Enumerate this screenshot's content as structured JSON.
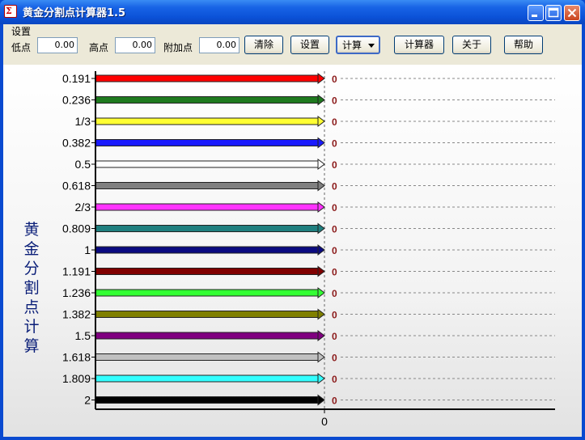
{
  "window": {
    "title": "黄金分割点计算器1.5",
    "icon": "golden-ratio-app-icon"
  },
  "toolbar": {
    "menu_label": "设置",
    "low_label": "低点",
    "low_value": "0.00",
    "high_label": "高点",
    "high_value": "0.00",
    "extra_label": "附加点",
    "extra_value": "0.00",
    "clear_label": "清除",
    "settings_label": "设置",
    "calc_label": "计算",
    "calculator_label": "计算器",
    "about_label": "关于",
    "help_label": "帮助"
  },
  "chart_title": "黄金分割点计算",
  "chart_data": {
    "type": "bar",
    "orientation": "horizontal",
    "categories": [
      "0.191",
      "0.236",
      "1/3",
      "0.382",
      "0.5",
      "0.618",
      "2/3",
      "0.809",
      "1",
      "1.191",
      "1.236",
      "1.382",
      "1.5",
      "1.618",
      "1.809",
      "2"
    ],
    "values": [
      0,
      0,
      0,
      0,
      0,
      0,
      0,
      0,
      0,
      0,
      0,
      0,
      0,
      0,
      0,
      0
    ],
    "value_labels": [
      "0",
      "0",
      "0",
      "0",
      "0",
      "0",
      "0",
      "0",
      "0",
      "0",
      "0",
      "0",
      "0",
      "0",
      "0",
      "0"
    ],
    "colors": [
      "#ff0000",
      "#1f7a1f",
      "#ffff33",
      "#1a1aff",
      "#ffffff",
      "#808080",
      "#ff33ff",
      "#1f7f7f",
      "#0a0a80",
      "#800000",
      "#33ff33",
      "#808000",
      "#800080",
      "#c0c0c0",
      "#33ffff",
      "#000000"
    ],
    "x_tick_labels": [
      "0"
    ],
    "grid": "dashed horizontal lines from zero line",
    "title": "黄金分割点计算"
  }
}
